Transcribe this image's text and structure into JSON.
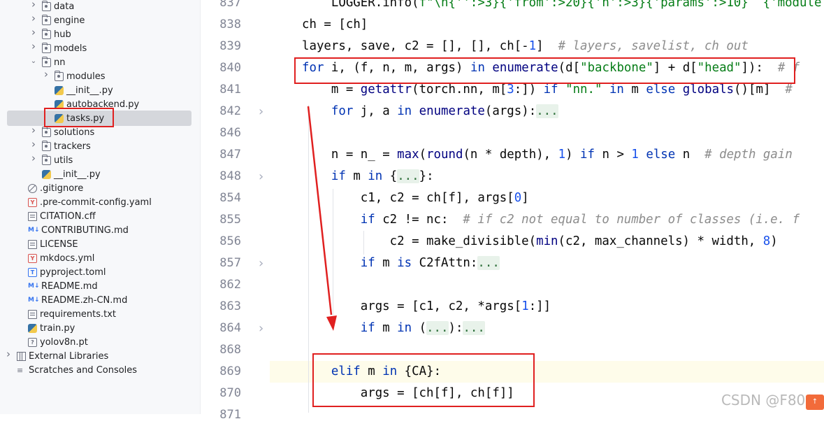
{
  "project_tree": {
    "items": [
      {
        "label": "data",
        "type": "folder",
        "depth": 1,
        "expanded": false
      },
      {
        "label": "engine",
        "type": "folder",
        "depth": 1,
        "expanded": false
      },
      {
        "label": "hub",
        "type": "folder",
        "depth": 1,
        "expanded": false
      },
      {
        "label": "models",
        "type": "folder",
        "depth": 1,
        "expanded": false
      },
      {
        "label": "nn",
        "type": "folder",
        "depth": 1,
        "expanded": true
      },
      {
        "label": "modules",
        "type": "folder",
        "depth": 2,
        "expanded": false
      },
      {
        "label": "__init__.py",
        "type": "python",
        "depth": 2
      },
      {
        "label": "autobackend.py",
        "type": "python",
        "depth": 2
      },
      {
        "label": "tasks.py",
        "type": "python",
        "depth": 2,
        "selected": true
      },
      {
        "label": "solutions",
        "type": "folder",
        "depth": 1,
        "expanded": false
      },
      {
        "label": "trackers",
        "type": "folder",
        "depth": 1,
        "expanded": false
      },
      {
        "label": "utils",
        "type": "folder",
        "depth": 1,
        "expanded": false
      },
      {
        "label": "__init__.py",
        "type": "python",
        "depth": 1
      },
      {
        "label": ".gitignore",
        "type": "ignore",
        "depth": 0
      },
      {
        "label": ".pre-commit-config.yaml",
        "type": "yaml",
        "depth": 0
      },
      {
        "label": "CITATION.cff",
        "type": "text",
        "depth": 0
      },
      {
        "label": "CONTRIBUTING.md",
        "type": "markdown",
        "depth": 0
      },
      {
        "label": "LICENSE",
        "type": "text",
        "depth": 0
      },
      {
        "label": "mkdocs.yml",
        "type": "yaml",
        "depth": 0
      },
      {
        "label": "pyproject.toml",
        "type": "toml",
        "depth": 0
      },
      {
        "label": "README.md",
        "type": "markdown",
        "depth": 0
      },
      {
        "label": "README.zh-CN.md",
        "type": "markdown",
        "depth": 0
      },
      {
        "label": "requirements.txt",
        "type": "text",
        "depth": 0
      },
      {
        "label": "train.py",
        "type": "python",
        "depth": 0
      },
      {
        "label": "yolov8n.pt",
        "type": "pt",
        "depth": 0
      },
      {
        "label": "External Libraries",
        "type": "library",
        "depth": -1,
        "expanded": false
      },
      {
        "label": "Scratches and Consoles",
        "type": "scratch",
        "depth": -1
      }
    ],
    "icon_glyphs": {
      "yaml": "Y",
      "toml": "T",
      "pt": "?",
      "markdown": "M↓",
      "scratch": "≡"
    }
  },
  "editor": {
    "lines": [
      {
        "num": "837",
        "indent": 0,
        "html": "    LOGGER.info(f\"\\n{'':>3}{'from':>20}{'n':>3}{'params':>10}  {'module"
      },
      {
        "num": "838",
        "indent": 0,
        "html": "ch = [ch]"
      },
      {
        "num": "839",
        "indent": 0,
        "html": "layers, save, c2 = [], [], ch[-1]  # layers, savelist, ch out"
      },
      {
        "num": "840",
        "indent": 0,
        "html": "for i, (f, n, m, args) in enumerate(d[\"backbone\"] + d[\"head\"]):  # f"
      },
      {
        "num": "841",
        "indent": 1,
        "html": "    m = getattr(torch.nn, m[3:]) if \"nn.\" in m else globals()[m]  #"
      },
      {
        "num": "842",
        "indent": 1,
        "html": "    for j, a in enumerate(args):...",
        "fold": true
      },
      {
        "num": "846",
        "indent": 1,
        "html": ""
      },
      {
        "num": "847",
        "indent": 1,
        "html": "    n = n_ = max(round(n * depth), 1) if n > 1 else n  # depth gain"
      },
      {
        "num": "848",
        "indent": 1,
        "html": "    if m in {...}:",
        "fold": true
      },
      {
        "num": "854",
        "indent": 2,
        "html": "        c1, c2 = ch[f], args[0]"
      },
      {
        "num": "855",
        "indent": 2,
        "html": "        if c2 != nc:  # if c2 not equal to number of classes (i.e. f"
      },
      {
        "num": "856",
        "indent": 3,
        "html": "            c2 = make_divisible(min(c2, max_channels) * width, 8)"
      },
      {
        "num": "857",
        "indent": 2,
        "html": "        if m is C2fAttn:...",
        "fold": true
      },
      {
        "num": "862",
        "indent": 2,
        "html": ""
      },
      {
        "num": "863",
        "indent": 2,
        "html": "        args = [c1, c2, *args[1:]]"
      },
      {
        "num": "864",
        "indent": 2,
        "html": "        if m in (...):...",
        "fold": true
      },
      {
        "num": "868",
        "indent": 1,
        "html": ""
      },
      {
        "num": "869",
        "indent": 1,
        "html": "    elif m in {CA}:",
        "current": true
      },
      {
        "num": "870",
        "indent": 2,
        "html": "        args = [ch[f], ch[f]]"
      },
      {
        "num": "871",
        "indent": 1,
        "html": ""
      }
    ]
  },
  "watermark": {
    "text": "CSDN @F800",
    "logo": "↑"
  },
  "colors": {
    "highlight_box": "#e02020",
    "keyword": "#0033b3",
    "string": "#067d17",
    "number": "#1750eb",
    "comment": "#8c8c8c",
    "current_line": "#fefcea"
  }
}
